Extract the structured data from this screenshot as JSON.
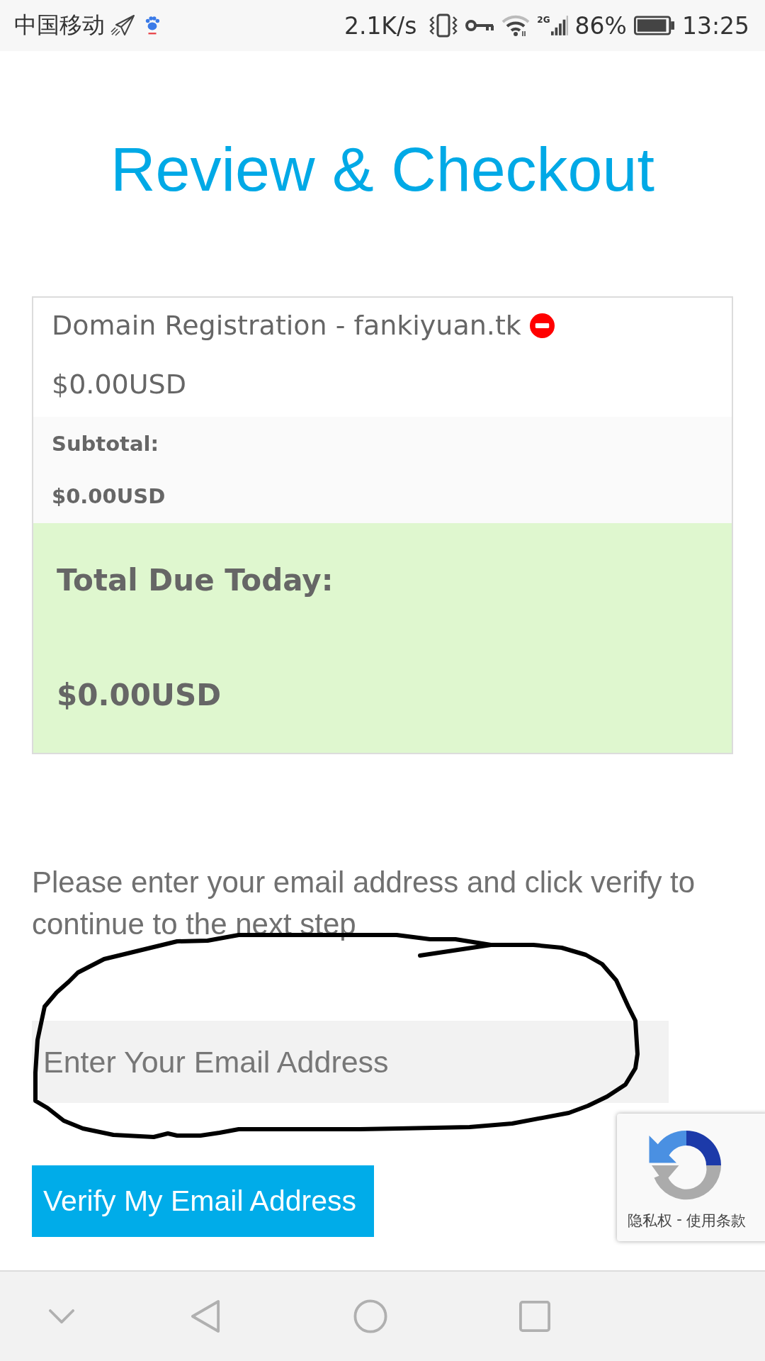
{
  "status_bar": {
    "carrier": "中国移动",
    "speed": "2.1K/s",
    "network": "2G",
    "battery": "86%",
    "time": "13:25"
  },
  "page": {
    "title": "Review & Checkout"
  },
  "order_summary": {
    "items": [
      {
        "name": "Domain Registration - fankiyuan.tk",
        "price": "$0.00USD"
      }
    ],
    "subtotal_label": "Subtotal:",
    "subtotal": "$0.00USD",
    "total_label": "Total Due Today:",
    "total": "$0.00USD"
  },
  "email_verification": {
    "instructions": "Please enter your email address and click verify to continue to the next step",
    "email_field": {
      "placeholder": "Enter Your Email Address"
    },
    "button": "Verify My Email Address"
  },
  "recaptcha": {
    "links": [
      "隐私权",
      "使用条款"
    ],
    "separator": "-"
  }
}
